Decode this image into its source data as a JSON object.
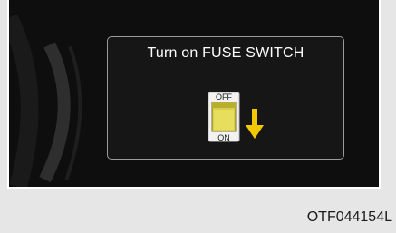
{
  "message": "Turn on FUSE SWITCH",
  "fuse_switch": {
    "off_label": "OFF",
    "on_label": "ON",
    "position": "on"
  },
  "icons": {
    "arrow": "arrow-down-icon",
    "switch": "fuse-switch-icon"
  },
  "colors": {
    "background": "#0e0e0e",
    "text": "#ffffff",
    "switch_body": "#d8d04a",
    "arrow": "#f2c800"
  },
  "image_code": "OTF044154L"
}
